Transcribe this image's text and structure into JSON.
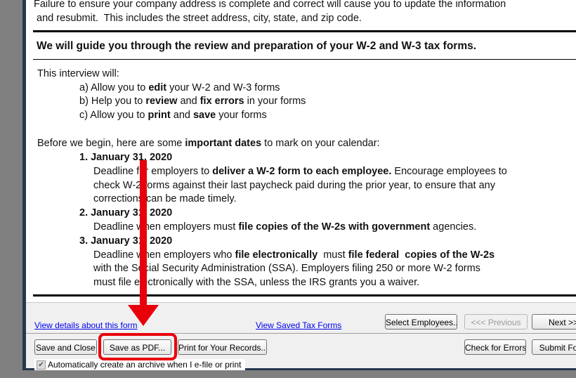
{
  "intro": {
    "line1": "Failure to ensure your company address is complete and correct will cause you to update the information",
    "line2": " and resubmit.  This includes the street address, city, state, and zip code."
  },
  "heading": "We will guide you through the review and preparation of your W-2 and W-3 tax forms.",
  "interview": {
    "lead": "This interview will:",
    "a": [
      "a) Allow you to ",
      "edit",
      " your W-2 and W-3 forms"
    ],
    "b": [
      "b) Help you to ",
      "review",
      " and ",
      "fix errors",
      " in your forms"
    ],
    "c": [
      "c) Allow you to ",
      "print",
      " and ",
      "save",
      " your forms"
    ]
  },
  "dates": {
    "lead": [
      "Before we begin, here are some ",
      "important dates",
      " to mark on your calendar:"
    ],
    "items": [
      {
        "title": "1. January 31, 2020",
        "l1": [
          "Deadline for employers to ",
          "deliver a W-2 form to each employee.",
          " Encourage employees to"
        ],
        "l2": "check W-2 forms against their last paycheck paid during the prior year, to ensure that any",
        "l3": "corrections can be made timely."
      },
      {
        "title": "2. January 31, 2020",
        "l1": [
          "Deadline when employers must ",
          "file copies of the W-2s with government",
          " agencies."
        ]
      },
      {
        "title": "3. January 31, 2020",
        "l1": [
          "Deadline when employers who ",
          "file electronically",
          "  must ",
          "file federal  copies of the W-2s"
        ],
        "l2": "with the Social Security Administration (SSA). Employers filing 250 or more W-2 forms",
        "l3": "must file electronically with the SSA, unless the IRS grants you a waiver."
      }
    ]
  },
  "links": {
    "details": "View details about this form",
    "saved": "View Saved Tax Forms"
  },
  "buttons": {
    "select": "Select Employees...",
    "previous": "<<<  Previous",
    "next": "Next  >>",
    "save_close": "Save and Close",
    "save_pdf": "Save as PDF...",
    "print": "Print for Your Records...",
    "check": "Check for Errors",
    "submit": "Submit Form"
  },
  "archive": {
    "label": "Automatically create an archive when I e-file or print",
    "checked": true
  },
  "annotation_color": "#e8000b"
}
